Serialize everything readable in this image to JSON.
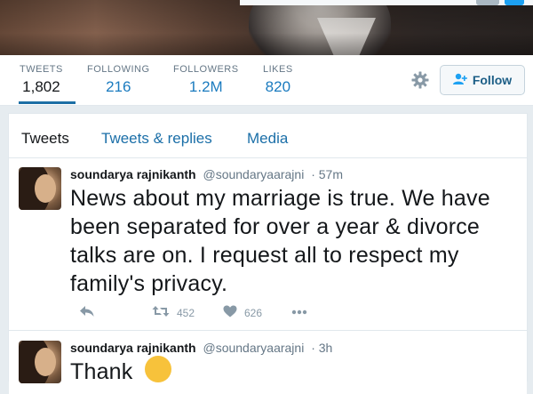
{
  "profile": {
    "stats": [
      {
        "label": "TWEETS",
        "value": "1,802"
      },
      {
        "label": "FOLLOWING",
        "value": "216"
      },
      {
        "label": "FOLLOWERS",
        "value": "1.2M"
      },
      {
        "label": "LIKES",
        "value": "820"
      }
    ],
    "follow_label": "Follow"
  },
  "tabs": [
    "Tweets",
    "Tweets & replies",
    "Media"
  ],
  "tweets": [
    {
      "name": "soundarya rajnikanth",
      "handle": "@soundaryaarajni",
      "time": "· 57m",
      "text": "News about my marriage is true. We have been separated for over a year & divorce talks are on. I request all to respect my family's privacy.",
      "retweets": "452",
      "likes": "626"
    },
    {
      "name": "soundarya rajnikanth",
      "handle": "@soundaryaarajni",
      "time": "· 3h",
      "text": "Thank"
    }
  ],
  "colors": {
    "accent": "#1da1f2",
    "link": "#1b6fa8",
    "muted": "#657786",
    "background": "#e6ecf0"
  },
  "icons": [
    "gear-icon",
    "add-user-icon",
    "reply-icon",
    "retweet-icon",
    "heart-icon",
    "more-icon"
  ]
}
